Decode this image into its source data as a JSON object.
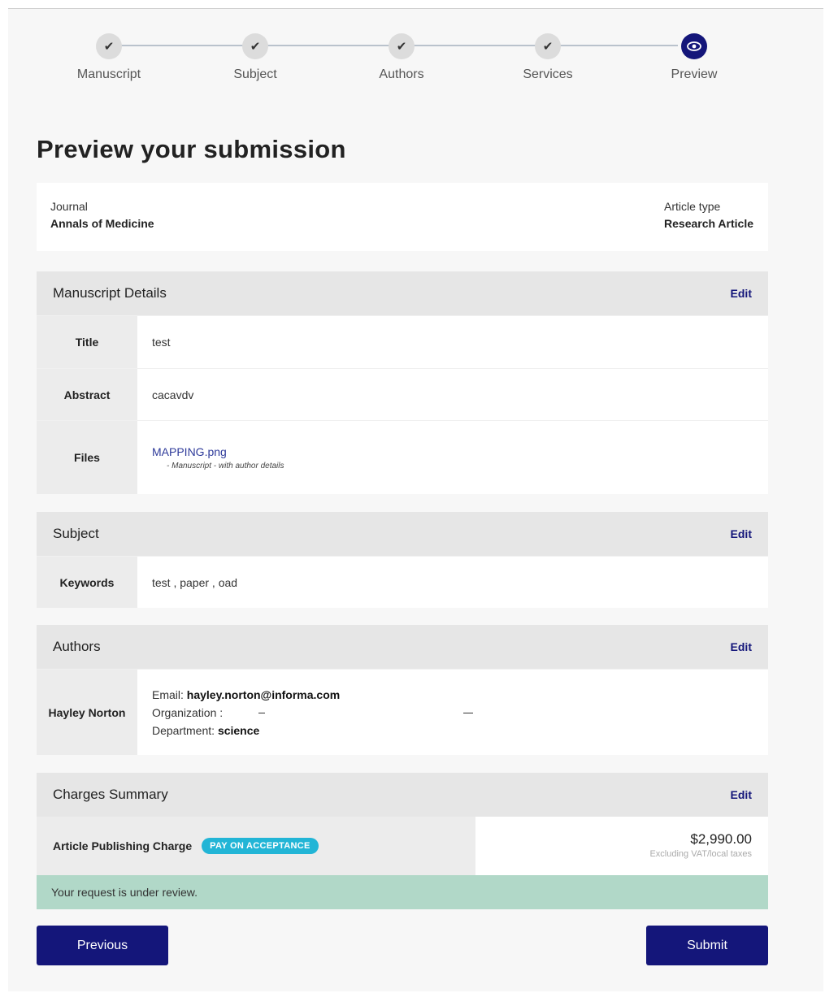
{
  "stepper": {
    "steps": [
      {
        "label": "Manuscript",
        "icon": "check-icon",
        "state": "done"
      },
      {
        "label": "Subject",
        "icon": "check-icon",
        "state": "done"
      },
      {
        "label": "Authors",
        "icon": "check-icon",
        "state": "done"
      },
      {
        "label": "Services",
        "icon": "check-icon",
        "state": "done"
      },
      {
        "label": "Preview",
        "icon": "eye-icon",
        "state": "active"
      }
    ]
  },
  "page_title": "Preview your submission",
  "journal_card": {
    "journal_label": "Journal",
    "journal_value": "Annals of Medicine",
    "article_type_label": "Article type",
    "article_type_value": "Research Article"
  },
  "manuscript": {
    "title": "Manuscript Details",
    "edit_label": "Edit",
    "title_label": "Title",
    "title_value": "test",
    "abstract_label": "Abstract",
    "abstract_value": "cacavdv",
    "files_label": "Files",
    "file_name": "MAPPING.png",
    "file_desc": "- Manuscript - with author details"
  },
  "subject": {
    "title": "Subject",
    "edit_label": "Edit",
    "keywords_label": "Keywords",
    "keywords_value": "test , paper , oad"
  },
  "authors": {
    "title": "Authors",
    "edit_label": "Edit",
    "name": "Hayley Norton",
    "email_label": "Email:",
    "email_value": "hayley.norton@informa.com",
    "org_label": "Organization :",
    "org_value": "",
    "dept_label": "Department:",
    "dept_value": "science"
  },
  "charges": {
    "title": "Charges Summary",
    "edit_label": "Edit",
    "apc_label": "Article Publishing Charge",
    "badge": "PAY ON ACCEPTANCE",
    "price": "$2,990.00",
    "tax_note": "Excluding VAT/local taxes",
    "status": "Your request is under review."
  },
  "buttons": {
    "previous": "Previous",
    "submit": "Submit"
  },
  "colors": {
    "primary": "#14167a",
    "badge": "#22b5d6",
    "status_bg": "#b1d8c8"
  }
}
